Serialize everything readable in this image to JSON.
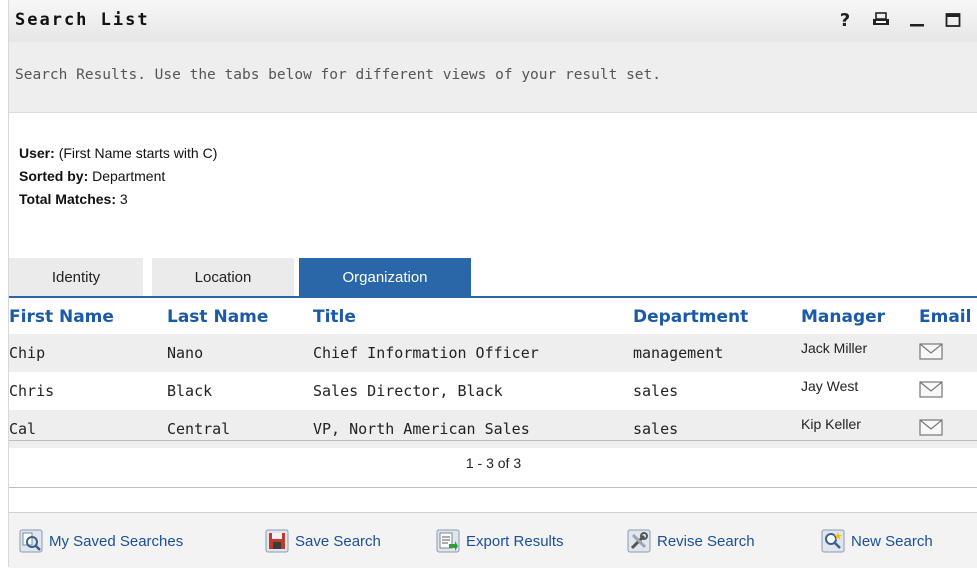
{
  "window": {
    "title": "Search List",
    "help_glyph": "?"
  },
  "intro": "Search Results. Use the tabs below for different views of your result set.",
  "criteria": {
    "user_label": "User:",
    "user_value": "(First Name starts with C)",
    "sorted_label": "Sorted by:",
    "sorted_value": "Department",
    "total_label": "Total Matches:",
    "total_value": "3"
  },
  "tabs": [
    {
      "label": "Identity",
      "active": false
    },
    {
      "label": "Location",
      "active": false
    },
    {
      "label": "Organization",
      "active": true
    }
  ],
  "table": {
    "headers": [
      "First Name",
      "Last Name",
      "Title",
      "Department",
      "Manager",
      "Email"
    ],
    "rows": [
      {
        "first": "Chip",
        "last": "Nano",
        "title": "Chief Information Officer",
        "department": "management",
        "manager": "Jack Miller",
        "email_icon": "envelope-icon"
      },
      {
        "first": "Chris",
        "last": "Black",
        "title": "Sales Director, Black",
        "department": "sales",
        "manager": "Jay West",
        "email_icon": "envelope-icon"
      },
      {
        "first": "Cal",
        "last": "Central",
        "title": "VP, North American Sales",
        "department": "sales",
        "manager": "Kip Keller",
        "email_icon": "envelope-icon"
      }
    ]
  },
  "pager": "1 - 3 of 3",
  "actions": [
    {
      "label": "My Saved Searches",
      "icon": "saved-searches-icon"
    },
    {
      "label": "Save Search",
      "icon": "save-disk-icon"
    },
    {
      "label": "Export Results",
      "icon": "export-icon"
    },
    {
      "label": "Revise Search",
      "icon": "revise-tools-icon"
    },
    {
      "label": "New Search",
      "icon": "new-search-icon"
    }
  ],
  "colors": {
    "accent": "#2a67a8",
    "header_text": "#1a5aa8",
    "stripe": "#eeeeee"
  }
}
